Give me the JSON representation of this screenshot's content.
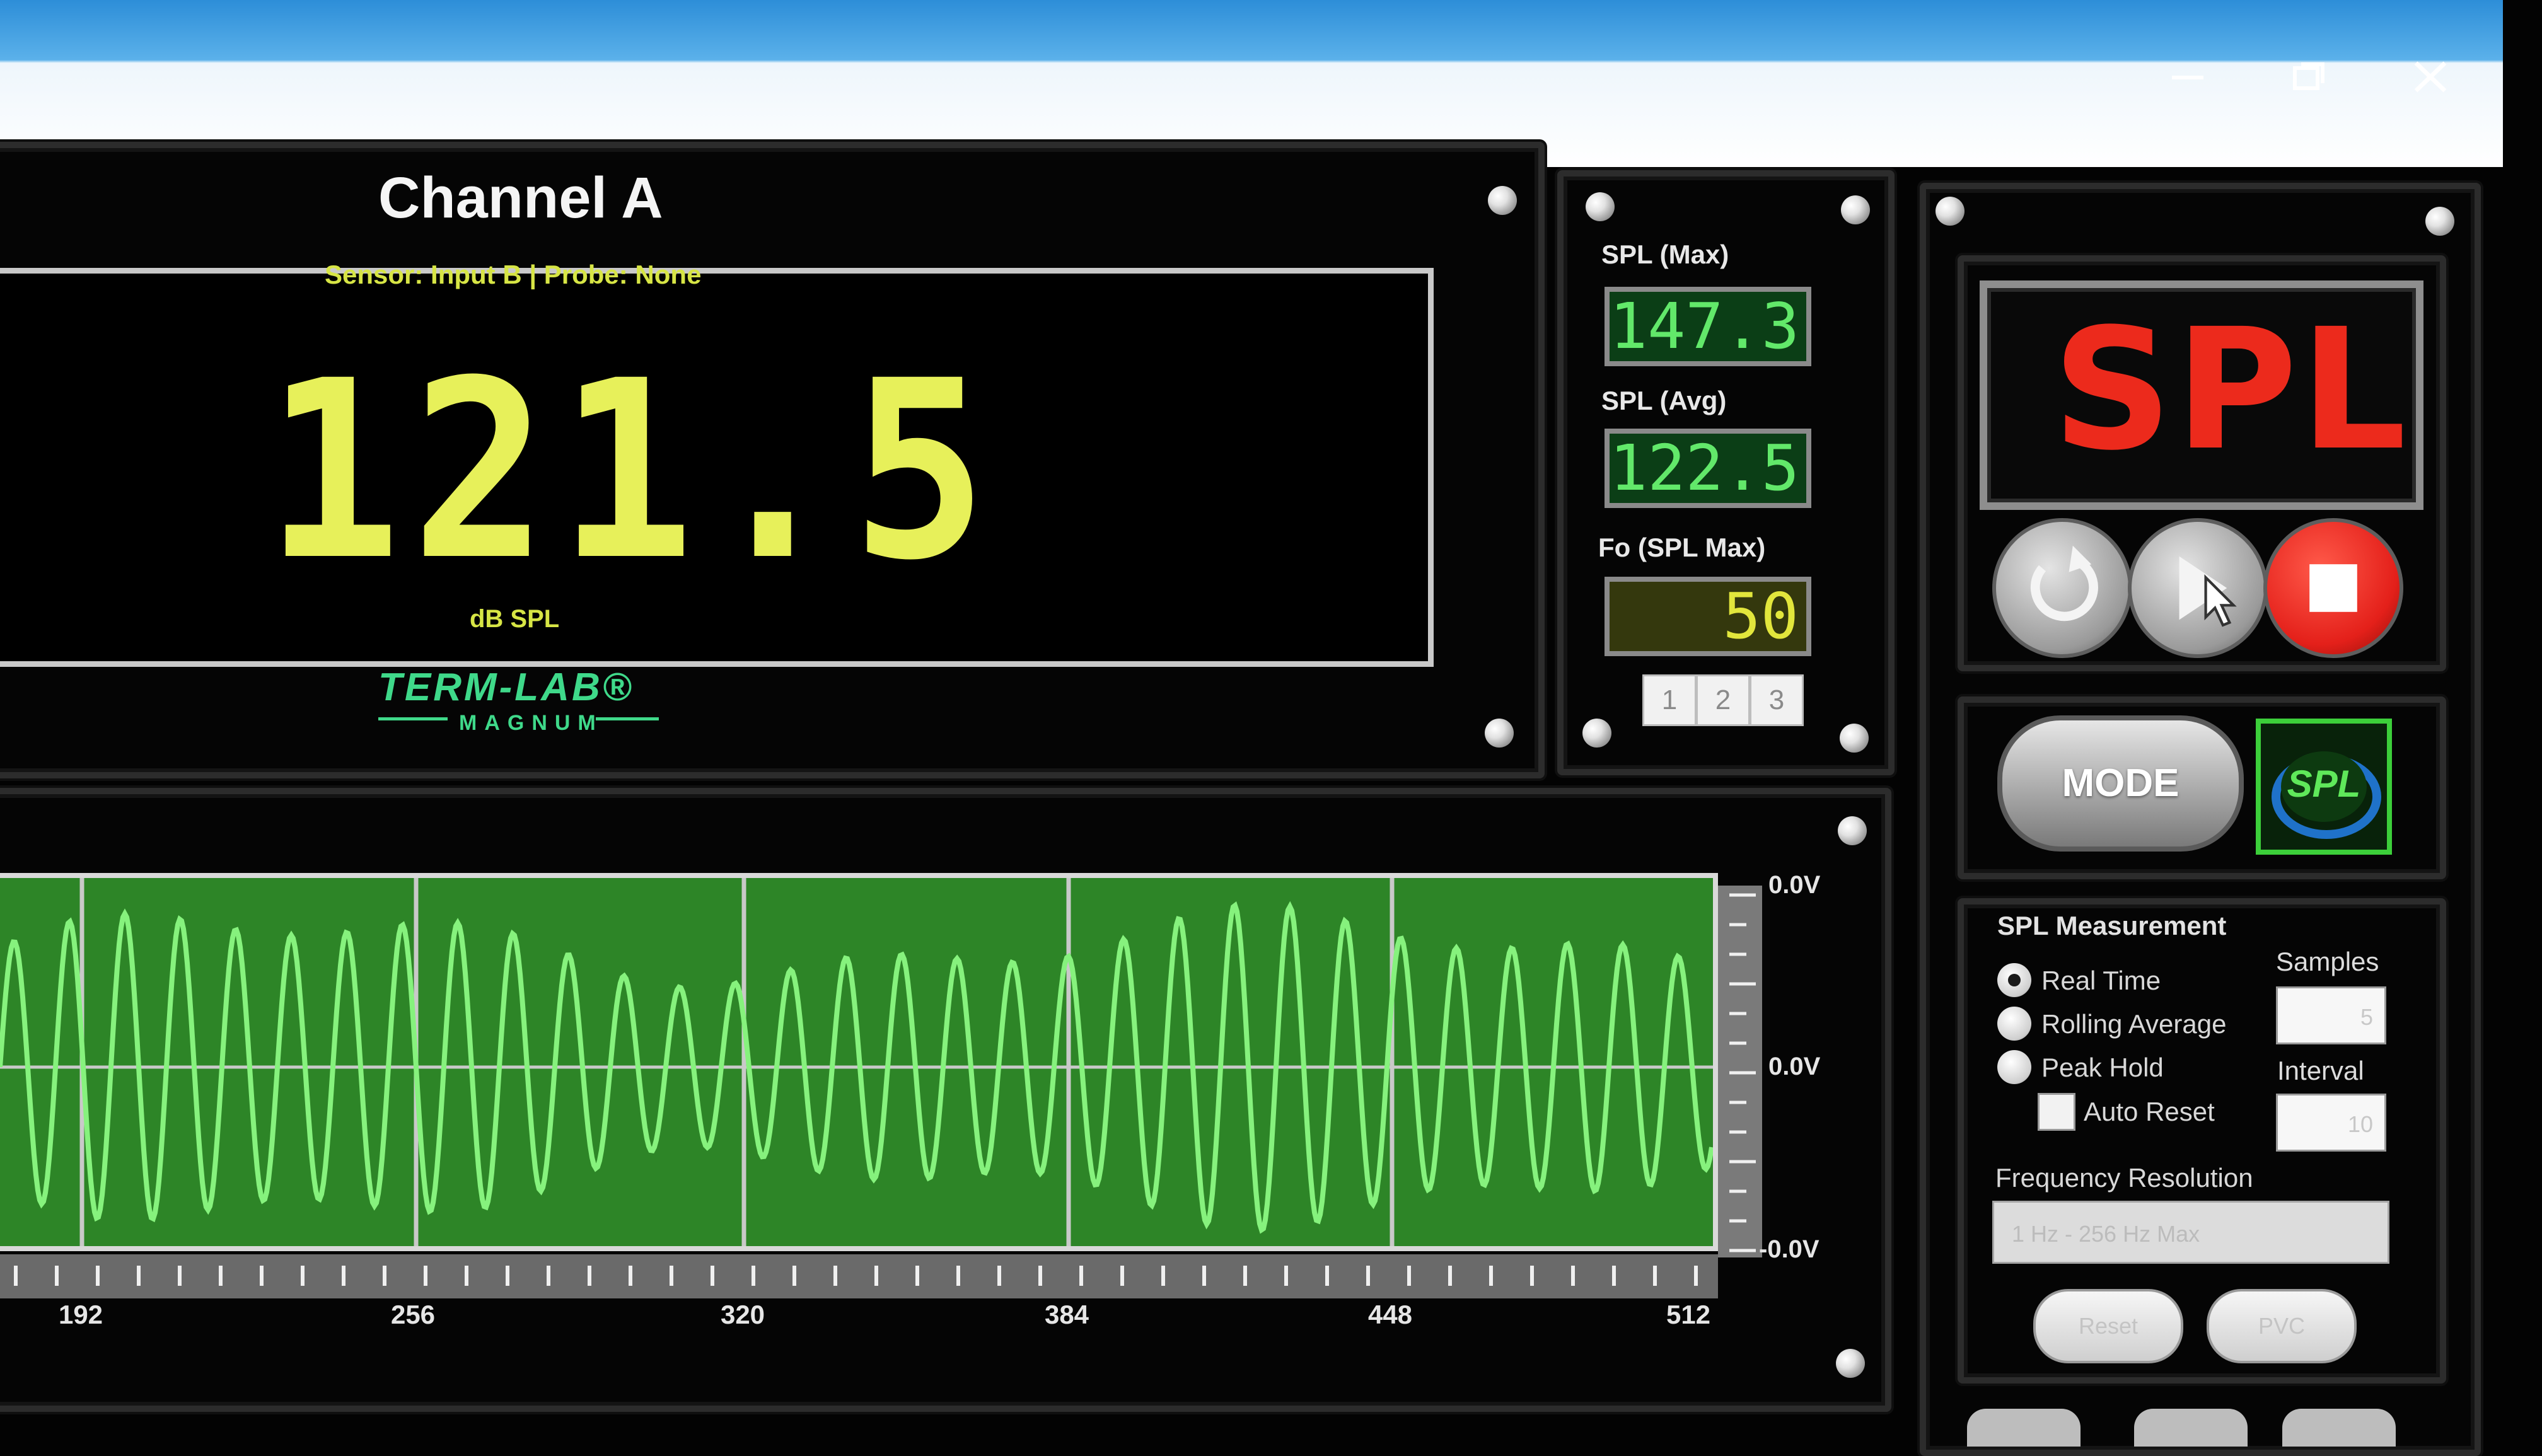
{
  "window": {
    "controls": [
      "minimize-icon",
      "maximize-icon",
      "close-icon"
    ]
  },
  "channel": {
    "title": "Channel A",
    "sensor_info": "Sensor: Input B | Probe: None",
    "reading": "121.5",
    "unit": "dB SPL",
    "logo_main": "TERM-LAB®",
    "logo_sub": "MAGNUM"
  },
  "stats": {
    "max_label": "SPL (Max)",
    "max_value": "147.3",
    "avg_label": "SPL (Avg)",
    "avg_value": "122.5",
    "fo_label": "Fo (SPL Max)",
    "fo_value": "50",
    "pages": [
      "1",
      "2",
      "3"
    ]
  },
  "controls": {
    "mode_display": "SPL",
    "buttons": [
      "reset-icon",
      "play-icon",
      "stop-icon"
    ],
    "mode_button": "MODE",
    "mode_logo": "SPL"
  },
  "measurement": {
    "title": "SPL Measurement",
    "options": [
      "Real Time",
      "Rolling Average",
      "Peak Hold"
    ],
    "selected": "Real Time",
    "auto_reset_label": "Auto Reset",
    "samples_label": "Samples",
    "samples_value": "5",
    "interval_label": "Interval",
    "interval_value": "10",
    "freq_res_label": "Frequency Resolution",
    "freq_res_value": "1 Hz - 256 Hz Max",
    "reset_button": "Reset",
    "pvc_button": "PVC"
  },
  "scope": {
    "y_labels": [
      "0.0V",
      "0.0V",
      "-0.0V"
    ],
    "x_labels": [
      "192",
      "256",
      "320",
      "384",
      "448",
      "512"
    ],
    "trace_color": "#86f27d",
    "background_color": "#2d8527"
  },
  "colors": {
    "reading": "#e7f05a",
    "spl_red": "#ec2a1c",
    "stat_green": "#62e86a",
    "stat_yellow": "#e2e63c"
  }
}
